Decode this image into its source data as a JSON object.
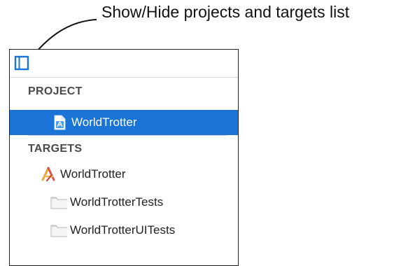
{
  "callout": {
    "text": "Show/Hide projects and targets list"
  },
  "toolbar": {
    "toggle_icon": "sidebar-toggle-icon",
    "accent_color": "#1a73d6"
  },
  "sections": {
    "project": {
      "header": "PROJECT",
      "items": [
        {
          "label": "WorldTrotter",
          "icon": "xcode-project-icon",
          "selected": true
        }
      ]
    },
    "targets": {
      "header": "TARGETS",
      "items": [
        {
          "label": "WorldTrotter",
          "icon": "app-target-icon",
          "selected": false
        },
        {
          "label": "WorldTrotterTests",
          "icon": "test-bundle-icon",
          "selected": false
        },
        {
          "label": "WorldTrotterUITests",
          "icon": "test-bundle-icon",
          "selected": false
        }
      ]
    }
  },
  "colors": {
    "selection": "#1a73d6",
    "header_text": "#4a4a4a",
    "separator": "#d6d6d6"
  }
}
